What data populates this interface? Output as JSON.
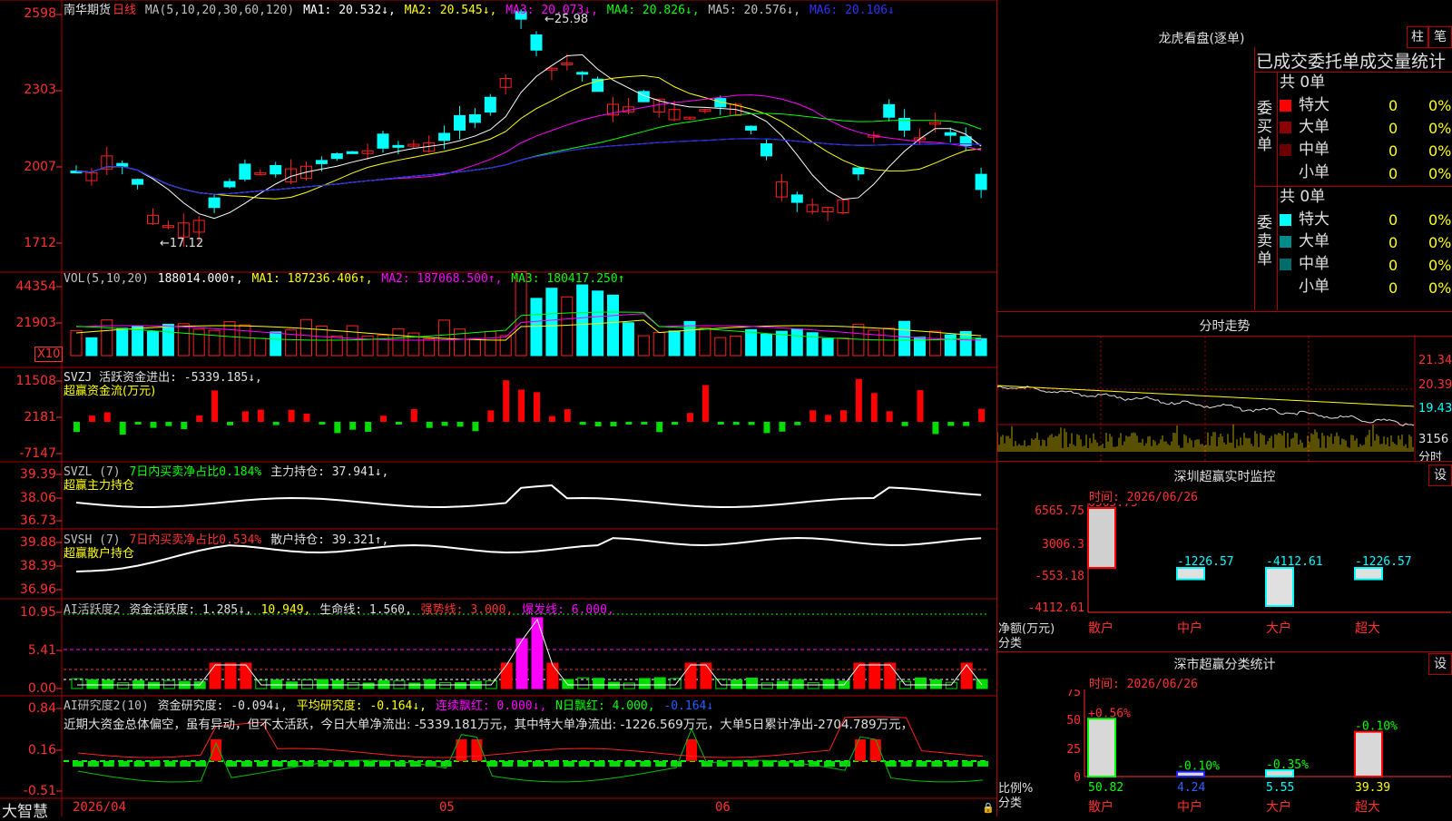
{
  "colors": {
    "up": "#ff2020",
    "down": "#00ffff",
    "ma1": "#ffffff",
    "ma2": "#ffff00",
    "ma3": "#ff00ff",
    "ma4": "#00ff00",
    "ma5": "#c0c0c0",
    "ma6": "#2020ff",
    "grid": "#b00000"
  },
  "main": {
    "name": "南华期货",
    "period": "日线",
    "ma_params": "MA(5,10,20,30,60,120)",
    "ma1": "MA1: 20.532↓,",
    "ma2": "MA2: 20.545↓,",
    "ma3": "MA3: 20.073↓,",
    "ma4": "MA4: 20.826↓,",
    "ma5": "MA5: 20.576↓,",
    "ma6": "MA6: 20.106↓",
    "y_ticks": [
      "2598",
      "2303",
      "2007",
      "1712"
    ],
    "high_label": "25.98",
    "low_label": "17.12"
  },
  "vol": {
    "params": "VOL(5,10,20)",
    "value": "188014.000↑,",
    "ma1": "MA1: 187236.406↑,",
    "ma2": "MA2: 187068.500↑,",
    "ma3": "MA3: 180417.250↑",
    "y_ticks": [
      "44354",
      "21903"
    ],
    "unit": "X10"
  },
  "svzj": {
    "title": "SVZJ  活跃资金进出: -5339.185↓,",
    "subtitle": "超赢资金流(万元)",
    "y_ticks": [
      "11508",
      "2181",
      "-7147"
    ]
  },
  "svzl": {
    "title": "SVZL (7)",
    "ratio": "7日内买卖净占比0.184%",
    "hold": "主力持仓: 37.941↓,",
    "subtitle": "超赢主力持仓",
    "y_ticks": [
      "39.39",
      "38.06",
      "36.73"
    ]
  },
  "svsh": {
    "title": "SVSH (7)",
    "ratio": "7日内买卖净占比0.534%",
    "hold": "散户持仓: 39.321↑,",
    "subtitle": "超赢散户持仓",
    "y_ticks": [
      "39.88",
      "38.39",
      "36.96"
    ]
  },
  "ai1": {
    "title": "AI活跃度2",
    "a": "资金活跃度: 1.285↓,",
    "b": "10.949,",
    "c": "生命线: 1.560,",
    "d": "强势线: 3.000,",
    "e": "爆发线: 6.000,",
    "y_ticks": [
      "10.95",
      "5.41",
      "0.00"
    ]
  },
  "ai2": {
    "title": "AI研究度2(10)",
    "a": "资金研究度: -0.094↓,",
    "b": "平均研究度: -0.164↓,",
    "c": "连续飘红: 0.000↓,",
    "d": "N日飘红: 4.000,",
    "e": "-0.164↓",
    "comment": "近期大资金总体偏空，虽有异动，但不太活跃，今日大单净流出: -5339.181万元，其中特大单净流出: -1226.569万元，大单5日累计净出-2704.789万元，",
    "y_ticks": [
      "0.84",
      "0.16",
      "-0.51"
    ]
  },
  "xaxis": {
    "brand": "大智慧",
    "d1": "2026/04",
    "d2": "05",
    "d3": "06"
  },
  "dragon": {
    "title": "龙虎看盘(逐单)",
    "btn1": "柱",
    "btn2": "笔",
    "header": "已成交委托单成交量统计",
    "buy_label": "委买单",
    "sell_label": "委卖单",
    "buy_total": "共 0单",
    "sell_total": "共 0单",
    "buy_rows": [
      {
        "name": "特大",
        "v": "0",
        "p": "0%"
      },
      {
        "name": "大单",
        "v": "0",
        "p": "0%"
      },
      {
        "name": "中单",
        "v": "0",
        "p": "0%"
      },
      {
        "name": "小单",
        "v": "0",
        "p": "0%"
      }
    ],
    "sell_rows": [
      {
        "name": "特大",
        "v": "0",
        "p": "0%"
      },
      {
        "name": "大单",
        "v": "0",
        "p": "0%"
      },
      {
        "name": "中单",
        "v": "0",
        "p": "0%"
      },
      {
        "name": "小单",
        "v": "0",
        "p": "0%"
      }
    ]
  },
  "intraday": {
    "title": "分时走势",
    "y_ticks": [
      "21.34",
      "20.39",
      "19.43"
    ],
    "vol_tick": "3156",
    "label": "分时"
  },
  "monitor": {
    "title": "深圳超赢实时监控",
    "btn": "设",
    "time": "时间: 2026/06/26",
    "y_ticks": [
      "6565.75",
      "3006.3",
      "-553.18",
      "-4112.61"
    ],
    "ylabel": "净额(万元)",
    "xlabel": "分类",
    "bars": [
      {
        "cat": "散户",
        "v": "6565.75"
      },
      {
        "cat": "中户",
        "v": "-1226.57"
      },
      {
        "cat": "大户",
        "v": "-4112.61"
      },
      {
        "cat": "超大",
        "v": "-1226.57"
      }
    ]
  },
  "classify": {
    "title": "深市超赢分类统计",
    "btn": "设",
    "time": "时间: 2026/06/26",
    "y_ticks": [
      "75",
      "50",
      "25",
      "0"
    ],
    "ylabel": "比例%",
    "xlabel": "分类",
    "bars": [
      {
        "cat": "散户",
        "top": "+0.56%",
        "bottom": "50.82"
      },
      {
        "cat": "中户",
        "top": "-0.10%",
        "bottom": "4.24"
      },
      {
        "cat": "大户",
        "top": "-0.35%",
        "bottom": "5.55"
      },
      {
        "cat": "超大",
        "top": "-0.10%",
        "bottom": "39.39"
      }
    ]
  }
}
